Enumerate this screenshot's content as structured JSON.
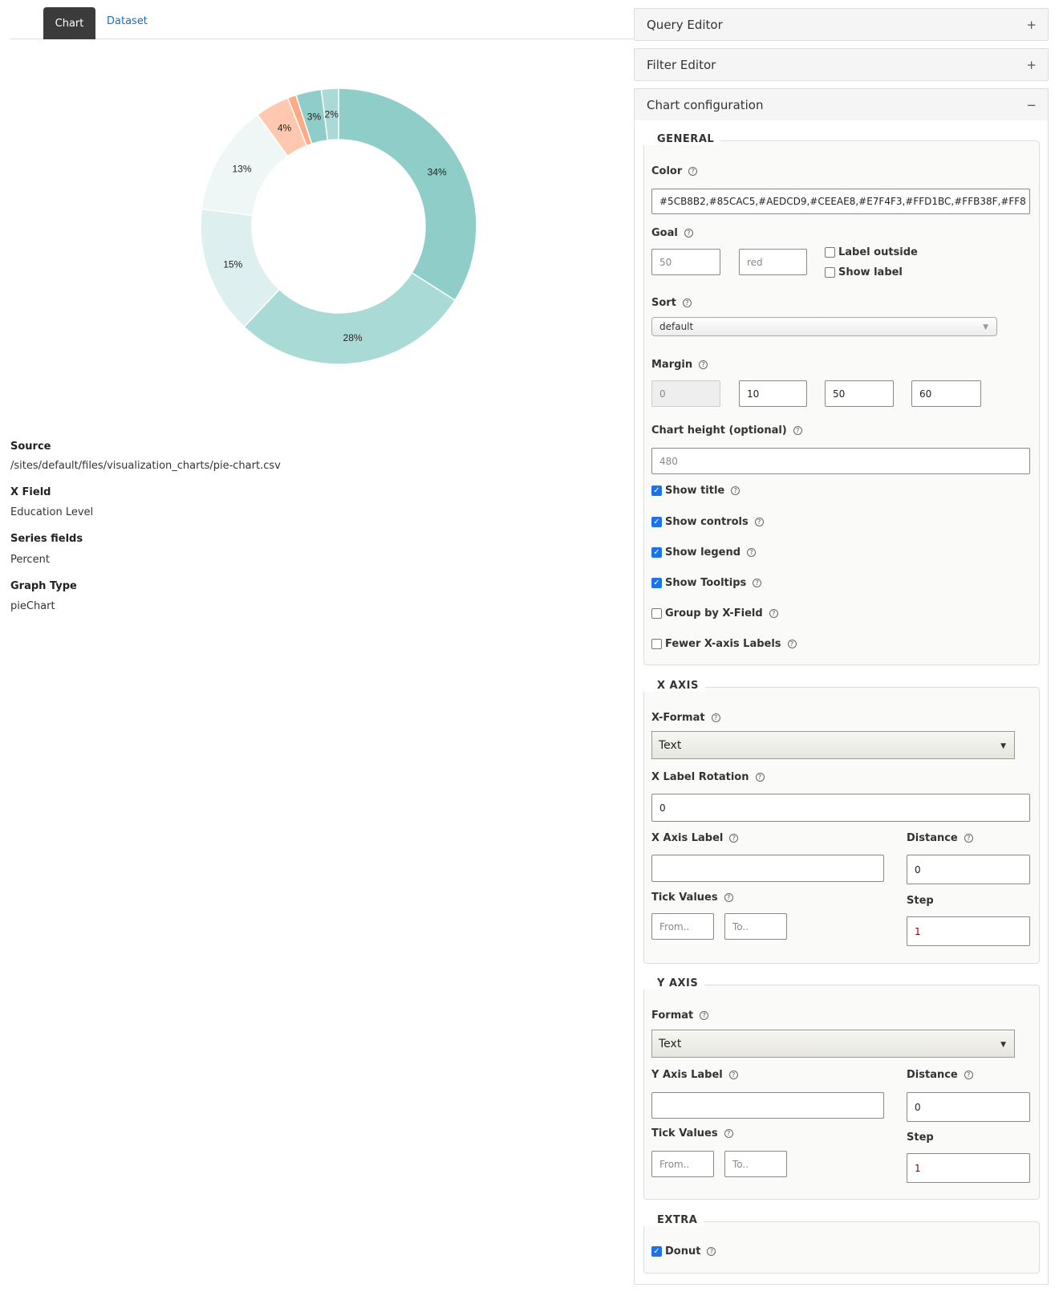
{
  "tabs": [
    {
      "label": "Chart",
      "active": true
    },
    {
      "label": "Dataset",
      "active": false
    }
  ],
  "chart_data": {
    "type": "pie",
    "donut": true,
    "series_name": "Percent",
    "x_field": "Education Level",
    "values": [
      34,
      28,
      15,
      13,
      4,
      1,
      3,
      2
    ],
    "labels": [
      "34%",
      "28%",
      "15%",
      "13%",
      "4%",
      "",
      "3%",
      "2%"
    ],
    "colors": [
      "#8FCDC8",
      "#AADAD6",
      "#DDEFEE",
      "#EEF7F6",
      "#FFC8AF",
      "#FFA985",
      "#8FCDC8",
      "#AADAD6"
    ]
  },
  "meta": [
    {
      "label": "Source",
      "value": "/sites/default/files/visualization_charts/pie-chart.csv"
    },
    {
      "label": "X Field",
      "value": "Education Level"
    },
    {
      "label": "Series fields",
      "value": "Percent"
    },
    {
      "label": "Graph Type",
      "value": "pieChart"
    }
  ],
  "panels": {
    "query_editor": {
      "title": "Query Editor",
      "sign": "+"
    },
    "filter_editor": {
      "title": "Filter Editor",
      "sign": "+"
    },
    "chart_config": {
      "title": "Chart configuration",
      "sign": "−"
    }
  },
  "general": {
    "legend": "GENERAL",
    "color_label": "Color",
    "color_value": "#5CB8B2,#85CAC5,#AEDCD9,#CEEAE8,#E7F4F3,#FFD1BC,#FFB38F,#FF8",
    "goal_label": "Goal",
    "goal_value_placeholder": "50",
    "goal_color_placeholder": "red",
    "label_outside": "Label outside",
    "show_label": "Show label",
    "sort_label": "Sort",
    "sort_value": "default",
    "margin_label": "Margin",
    "margins": [
      "0",
      "10",
      "50",
      "60"
    ],
    "chart_height_label": "Chart height (optional)",
    "chart_height_placeholder": "480",
    "checkboxes": [
      {
        "label": "Show title",
        "checked": true
      },
      {
        "label": "Show controls",
        "checked": true
      },
      {
        "label": "Show legend",
        "checked": true
      },
      {
        "label": "Show Tooltips",
        "checked": true
      },
      {
        "label": "Group by X-Field",
        "checked": false
      },
      {
        "label": "Fewer X-axis Labels",
        "checked": false
      }
    ]
  },
  "x_axis": {
    "legend": "X AXIS",
    "format_label": "X-Format",
    "format_value": "Text",
    "rotation_label": "X Label Rotation",
    "rotation_value": "0",
    "axis_label": "X Axis Label",
    "axis_value": "",
    "distance_label": "Distance",
    "distance_value": "0",
    "tick_label": "Tick Values",
    "from_placeholder": "From..",
    "to_placeholder": "To..",
    "step_label": "Step",
    "step_value": "1"
  },
  "y_axis": {
    "legend": "Y AXIS",
    "format_label": "Format",
    "format_value": "Text",
    "axis_label": "Y Axis Label",
    "axis_value": "",
    "distance_label": "Distance",
    "distance_value": "0",
    "tick_label": "Tick Values",
    "from_placeholder": "From..",
    "to_placeholder": "To..",
    "step_label": "Step",
    "step_value": "1"
  },
  "extra": {
    "legend": "EXTRA",
    "donut_label": "Donut",
    "donut_checked": true
  },
  "help_glyph": "?"
}
